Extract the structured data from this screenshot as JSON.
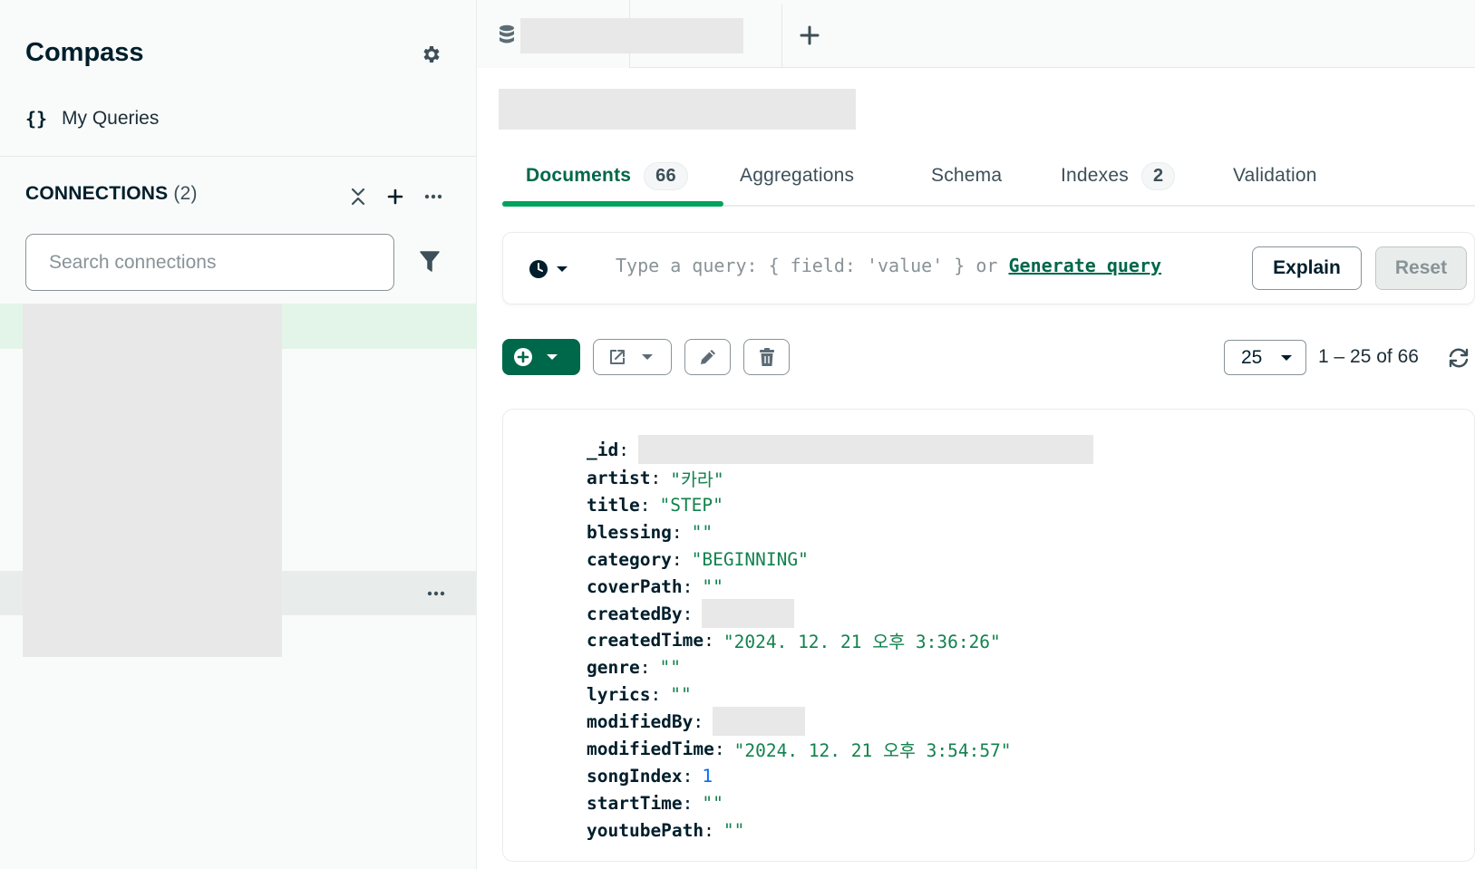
{
  "sidebar": {
    "app_title": "Compass",
    "my_queries_label": "My Queries",
    "connections_label": "CONNECTIONS",
    "connections_count": "(2)",
    "search_placeholder": "Search connections"
  },
  "tabs": {
    "sub_tabs": [
      {
        "label": "Documents",
        "badge": "66"
      },
      {
        "label": "Aggregations"
      },
      {
        "label": "Schema"
      },
      {
        "label": "Indexes",
        "badge": "2"
      },
      {
        "label": "Validation"
      }
    ]
  },
  "query": {
    "placeholder_text": "Type a query: { field: 'value' } or ",
    "generate_label": "Generate query",
    "explain_label": "Explain",
    "reset_label": "Reset"
  },
  "pagination": {
    "page_size": "25",
    "range": "1 – 25 of 66"
  },
  "document": {
    "fields": [
      {
        "key": "_id",
        "sep": ":",
        "type": "redacted"
      },
      {
        "key": "artist",
        "sep": " :",
        "value": "\"카라\"",
        "type": "string"
      },
      {
        "key": "title",
        "sep": " :",
        "value": "\"STEP\"",
        "type": "string"
      },
      {
        "key": "blessing",
        "sep": " :",
        "value": "\"\"",
        "type": "string"
      },
      {
        "key": "category",
        "sep": " :",
        "value": "\"BEGINNING\"",
        "type": "string"
      },
      {
        "key": "coverPath",
        "sep": " :",
        "value": "\"\"",
        "type": "string"
      },
      {
        "key": "createdBy",
        "sep": " :",
        "type": "redacted"
      },
      {
        "key": "createdTime",
        "sep": " :",
        "value": "\"2024. 12. 21 오후 3:36:26\"",
        "type": "string"
      },
      {
        "key": "genre",
        "sep": " :",
        "value": "\"\"",
        "type": "string"
      },
      {
        "key": "lyrics",
        "sep": " :",
        "value": "\"\"",
        "type": "string"
      },
      {
        "key": "modifiedBy",
        "sep": " :",
        "type": "redacted"
      },
      {
        "key": "modifiedTime",
        "sep": " :",
        "value": "\"2024. 12. 21 오후 3:54:57\"",
        "type": "string"
      },
      {
        "key": "songIndex",
        "sep": " :",
        "value": "1",
        "type": "number"
      },
      {
        "key": "startTime",
        "sep": " :",
        "value": "\"\"",
        "type": "string"
      },
      {
        "key": "youtubePath",
        "sep": " :",
        "value": "\"\"",
        "type": "string"
      }
    ]
  },
  "colors": {
    "accent_green": "#00684a",
    "tab_underline": "#00a35c",
    "string_value": "#12824d",
    "number_value": "#016bf8",
    "selected_connection": "#e3f4e8"
  },
  "icons": [
    "gear-icon",
    "braces-icon",
    "collapse-all-icon",
    "plus-icon",
    "ellipsis-icon",
    "filter-icon",
    "database-icon",
    "clock-icon",
    "chevron-down-icon",
    "plus-circle-icon",
    "export-icon",
    "pencil-icon",
    "trash-icon",
    "refresh-icon"
  ]
}
